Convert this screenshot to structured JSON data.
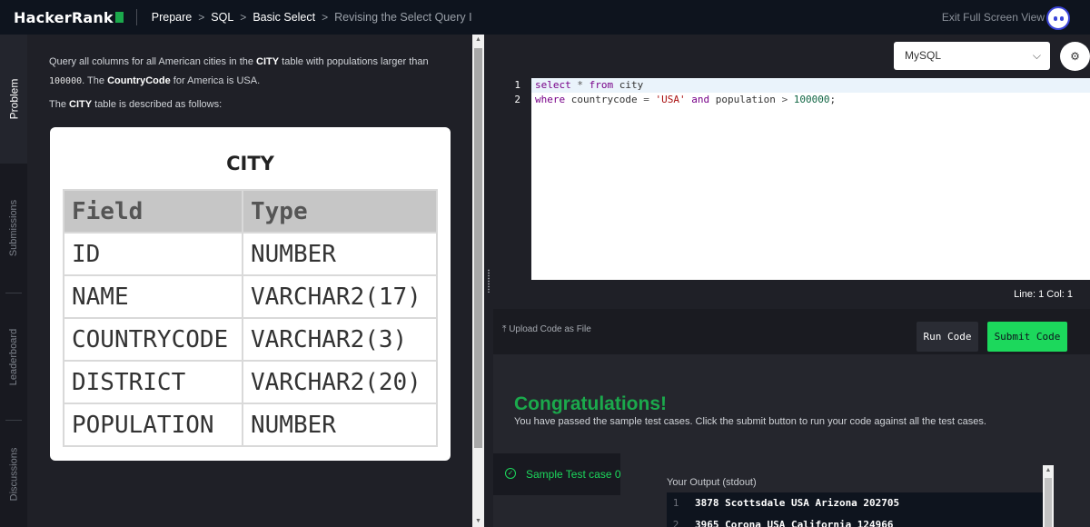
{
  "header": {
    "logo": "HackerRank",
    "breadcrumbs": [
      "Prepare",
      "SQL",
      "Basic Select",
      "Revising the Select Query I"
    ],
    "exit_label": "Exit Full Screen View"
  },
  "tabs": [
    "Problem",
    "Submissions",
    "Leaderboard",
    "Discussions"
  ],
  "problem": {
    "line1_pre": "Query all columns for all American cities in the ",
    "line1_bold": "CITY",
    "line1_post": " table with populations larger than",
    "line2_code": "100000",
    "line2_mid": ". The ",
    "line2_bold": "CountryCode",
    "line2_post": " for America is USA.",
    "line3_pre": "The ",
    "line3_bold": "CITY",
    "line3_post": " table is described as follows:",
    "table_title": "CITY",
    "headers": [
      "Field",
      "Type"
    ],
    "rows": [
      [
        "ID",
        "NUMBER"
      ],
      [
        "NAME",
        "VARCHAR2(17)"
      ],
      [
        "COUNTRYCODE",
        "VARCHAR2(3)"
      ],
      [
        "DISTRICT",
        "VARCHAR2(20)"
      ],
      [
        "POPULATION",
        "NUMBER"
      ]
    ]
  },
  "editor": {
    "language": "MySQL",
    "line_numbers": [
      "1",
      "2"
    ],
    "code_l1": {
      "k1": "select",
      "star": " * ",
      "k2": "from",
      "rest": " city"
    },
    "code_l2": {
      "k1": "where",
      "a": " countrycode ",
      "eq": "=",
      "s": " 'USA' ",
      "k2": "and",
      "b": " population ",
      "gt": ">",
      "n": " 100000",
      "end": ";"
    },
    "cursor_pos": "Line: 1 Col: 1"
  },
  "actions": {
    "upload": "Upload Code as File",
    "run": "Run Code",
    "submit": "Submit Code"
  },
  "results": {
    "title": "Congratulations!",
    "message": "You have passed the sample test cases. Click the submit button to run your code against all the test cases.",
    "case_label": "Sample Test case 0",
    "output_label": "Your Output (stdout)",
    "output_lines": [
      {
        "n": "1",
        "text": "3878 Scottsdale USA Arizona 202705"
      },
      {
        "n": "2",
        "text": "3965 Corona USA California 124966"
      }
    ]
  },
  "colors": {
    "accent_green": "#1cd85c",
    "topbar": "#0e141e",
    "background": "#1f2027"
  }
}
